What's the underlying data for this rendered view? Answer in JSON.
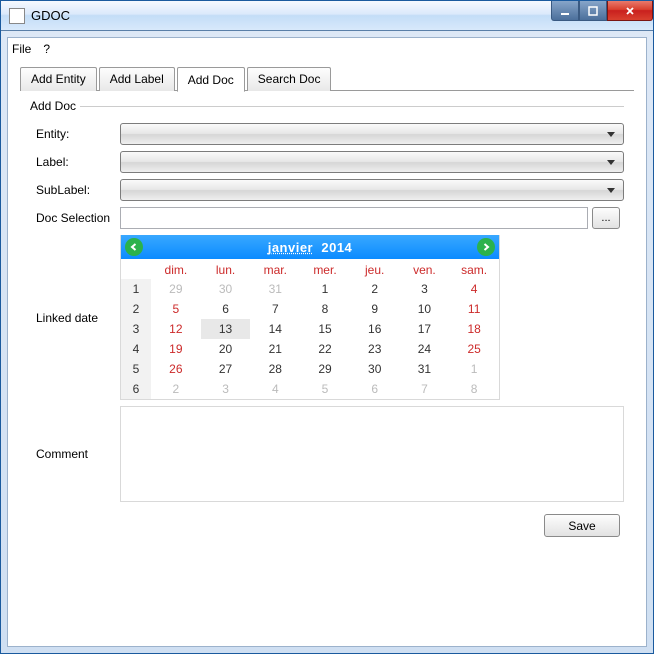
{
  "window": {
    "title": "GDOC"
  },
  "menu": {
    "file": "File",
    "help": "?"
  },
  "tabs": [
    "Add Entity",
    "Add Label",
    "Add Doc",
    "Search Doc"
  ],
  "active_tab": 2,
  "panel": {
    "legend": "Add Doc",
    "labels": {
      "entity": "Entity:",
      "label": "Label:",
      "sublabel": "SubLabel:",
      "docsel": "Doc Selection",
      "linked": "Linked date",
      "comment": "Comment"
    },
    "browse": "...",
    "save": "Save"
  },
  "calendar": {
    "month": "janvier",
    "year": "2014",
    "daynames": [
      "dim.",
      "lun.",
      "mar.",
      "mer.",
      "jeu.",
      "ven.",
      "sam."
    ],
    "weeks": [
      {
        "num": "1",
        "days": [
          {
            "n": "29",
            "cls": "out sun"
          },
          {
            "n": "30",
            "cls": "out"
          },
          {
            "n": "31",
            "cls": "out"
          },
          {
            "n": "1",
            "cls": ""
          },
          {
            "n": "2",
            "cls": ""
          },
          {
            "n": "3",
            "cls": ""
          },
          {
            "n": "4",
            "cls": "sat"
          }
        ]
      },
      {
        "num": "2",
        "days": [
          {
            "n": "5",
            "cls": "sun"
          },
          {
            "n": "6",
            "cls": ""
          },
          {
            "n": "7",
            "cls": ""
          },
          {
            "n": "8",
            "cls": ""
          },
          {
            "n": "9",
            "cls": ""
          },
          {
            "n": "10",
            "cls": ""
          },
          {
            "n": "11",
            "cls": "sat"
          }
        ]
      },
      {
        "num": "3",
        "days": [
          {
            "n": "12",
            "cls": "sun"
          },
          {
            "n": "13",
            "cls": "today"
          },
          {
            "n": "14",
            "cls": ""
          },
          {
            "n": "15",
            "cls": ""
          },
          {
            "n": "16",
            "cls": ""
          },
          {
            "n": "17",
            "cls": ""
          },
          {
            "n": "18",
            "cls": "sat"
          }
        ]
      },
      {
        "num": "4",
        "days": [
          {
            "n": "19",
            "cls": "sun"
          },
          {
            "n": "20",
            "cls": ""
          },
          {
            "n": "21",
            "cls": ""
          },
          {
            "n": "22",
            "cls": ""
          },
          {
            "n": "23",
            "cls": ""
          },
          {
            "n": "24",
            "cls": ""
          },
          {
            "n": "25",
            "cls": "sat"
          }
        ]
      },
      {
        "num": "5",
        "days": [
          {
            "n": "26",
            "cls": "sun"
          },
          {
            "n": "27",
            "cls": ""
          },
          {
            "n": "28",
            "cls": ""
          },
          {
            "n": "29",
            "cls": ""
          },
          {
            "n": "30",
            "cls": ""
          },
          {
            "n": "31",
            "cls": ""
          },
          {
            "n": "1",
            "cls": "out sat"
          }
        ]
      },
      {
        "num": "6",
        "days": [
          {
            "n": "2",
            "cls": "out sun"
          },
          {
            "n": "3",
            "cls": "out"
          },
          {
            "n": "4",
            "cls": "out"
          },
          {
            "n": "5",
            "cls": "out"
          },
          {
            "n": "6",
            "cls": "out"
          },
          {
            "n": "7",
            "cls": "out"
          },
          {
            "n": "8",
            "cls": "out sat"
          }
        ]
      }
    ]
  }
}
